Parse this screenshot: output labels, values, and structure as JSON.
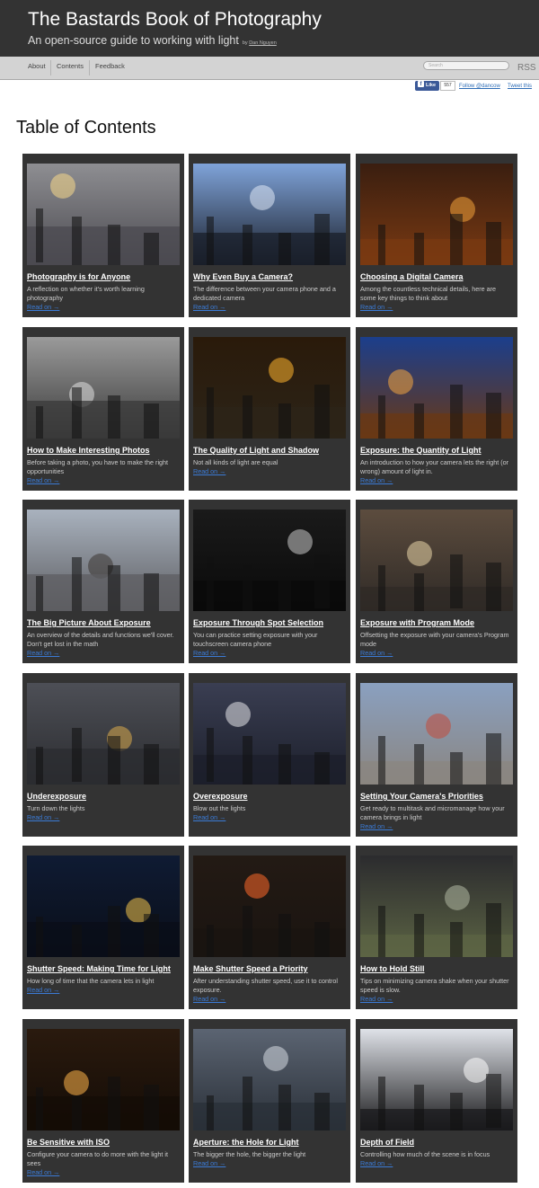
{
  "header": {
    "site_title": "The Bastards Book of Photography",
    "tagline": "An open-source guide to working with light",
    "byline_prefix": "by",
    "byline_author": "Dan Nguyen"
  },
  "nav": {
    "items": [
      "About",
      "Contents",
      "Feedback"
    ],
    "search_placeholder": "Search",
    "rss_label": "RSS"
  },
  "social": {
    "like_label": "Like",
    "like_count": "557",
    "follow_label": "Follow @dancow",
    "tweet_label": "Tweet this"
  },
  "page_title": "Table of Contents",
  "read_on_label": "Read on →",
  "cards": [
    {
      "title": "Photography is for Anyone",
      "desc": "A reflection on whether it's worth learning photography",
      "image": "city-crosswalk-sunset-photo"
    },
    {
      "title": "Why Even Buy a Camera?",
      "desc": "The difference between your camera phone and a dedicated camera",
      "image": "phone-photographer-silhouette-photo"
    },
    {
      "title": "Choosing a Digital Camera",
      "desc": "Among the countless technical details, here are some key things to think about",
      "image": "bowling-alley-photo"
    },
    {
      "title": "How to Make Interesting Photos",
      "desc": "Before taking a photo, you have to make the right opportunities",
      "image": "basketball-gym-photo"
    },
    {
      "title": "The Quality of Light and Shadow",
      "desc": "Not all kinds of light are equal",
      "image": "ferry-sunset-photo"
    },
    {
      "title": "Exposure: the Quantity of Light",
      "desc": "An introduction to how your camera lets the right (or wrong) amount of light in.",
      "image": "colosseum-night-photo"
    },
    {
      "title": "The Big Picture About Exposure",
      "desc": "An overview of the details and functions we'll cover. Don't get lost in the math",
      "image": "city-skyline-rooftop-photo"
    },
    {
      "title": "Exposure Through Spot Selection",
      "desc": "You can practice setting exposure with your touchscreen camera phone",
      "image": "dark-alley-photo"
    },
    {
      "title": "Exposure with Program Mode",
      "desc": "Offsetting the exposure with your camera's Program mode",
      "image": "florence-statue-night-photo"
    },
    {
      "title": "Underexposure",
      "desc": "Turn down the lights",
      "image": "rainy-street-photo"
    },
    {
      "title": "Overexposure",
      "desc": "Blow out the lights",
      "image": "police-officers-photo"
    },
    {
      "title": "Setting Your Camera's Priorities",
      "desc": "Get ready to multitask and micromanage how your camera brings in light",
      "image": "parade-crowd-photo"
    },
    {
      "title": "Shutter Speed: Making Time for Light",
      "desc": "How long of time that the camera lets in light",
      "image": "eiffel-tower-night-photo"
    },
    {
      "title": "Make Shutter Speed a Priority",
      "desc": "After understanding shutter speed, use it to control exposure.",
      "image": "times-square-traffic-photo"
    },
    {
      "title": "How to Hold Still",
      "desc": "Tips on minimizing camera shake when your shutter speed is slow.",
      "image": "bridge-photographer-photo"
    },
    {
      "title": "Be Sensitive with ISO",
      "desc": "Configure your camera to do more with the light it sees",
      "image": "night-street-shops-photo"
    },
    {
      "title": "Aperture: the Hole for Light",
      "desc": "The bigger the hole, the bigger the light",
      "image": "cloudy-skyline-photo"
    },
    {
      "title": "Depth of Field",
      "desc": "Controlling how much of the scene is in focus",
      "image": "concert-crowd-photo"
    }
  ]
}
